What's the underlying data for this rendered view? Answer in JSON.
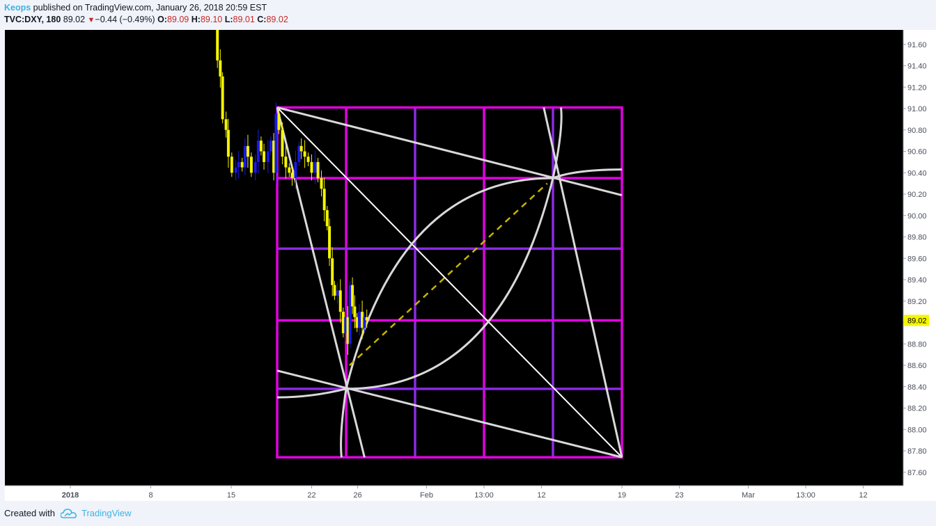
{
  "header": {
    "author": "Keops",
    "published": " published on TradingView.com, January 26, 2018 20:59 EST",
    "symbol": "TVC:DXY, 180",
    "last": "89.02",
    "down_arrow": "▼",
    "change": "−0.44 (−0.49%)",
    "o_label": "O:",
    "o_value": "89.09",
    "h_label": "H:",
    "h_value": "89.10",
    "l_label": "L:",
    "l_value": "89.01",
    "c_label": "C:",
    "c_value": "89.02"
  },
  "footer": {
    "created_with": "Created with",
    "brand": "TradingView",
    "logo_icon": "tradingview-cloud-icon"
  },
  "chart_data": {
    "type": "candlestick",
    "y_ticks": [
      "91.60",
      "91.40",
      "91.20",
      "91.00",
      "90.80",
      "90.60",
      "90.40",
      "90.20",
      "90.00",
      "89.80",
      "89.60",
      "89.40",
      "89.20",
      "89.00",
      "88.80",
      "88.60",
      "88.40",
      "88.20",
      "88.00",
      "87.80",
      "87.60"
    ],
    "ylim": [
      87.55,
      91.65
    ],
    "x_ticks": [
      {
        "label": "2018",
        "x": 1.0
      },
      {
        "label": "8",
        "x": 8.0
      },
      {
        "label": "15",
        "x": 15.0
      },
      {
        "label": "22",
        "x": 22.0
      },
      {
        "label": "26",
        "x": 26.0
      },
      {
        "label": "Feb",
        "x": 32.0
      },
      {
        "label": "13:00",
        "x": 37.0
      },
      {
        "label": "12",
        "x": 42.0
      },
      {
        "label": "19",
        "x": 49.0
      },
      {
        "label": "23",
        "x": 54.0
      },
      {
        "label": "Mar",
        "x": 60.0
      },
      {
        "label": "13:00",
        "x": 65.0
      },
      {
        "label": "12",
        "x": 70.0
      }
    ],
    "last_price": "89.02",
    "colors": {
      "up": "#1a1ae6",
      "down": "#f5f500",
      "grid_a": "#8a2be2",
      "grid_b": "#e100e1",
      "lines": "#d9d9d9",
      "dashed": "#c8b400",
      "price_tag": "#f5f500"
    },
    "price_path": [
      [
        13.6,
        91.75
      ],
      [
        13.8,
        91.45
      ],
      [
        14.05,
        91.3
      ],
      [
        14.25,
        90.9
      ],
      [
        14.55,
        90.8
      ],
      [
        14.75,
        90.55
      ],
      [
        15.05,
        90.4
      ],
      [
        15.4,
        90.45
      ],
      [
        15.65,
        90.5
      ],
      [
        15.95,
        90.45
      ],
      [
        16.2,
        90.65
      ],
      [
        16.45,
        90.55
      ],
      [
        16.75,
        90.4
      ],
      [
        17.1,
        90.5
      ],
      [
        17.35,
        90.7
      ],
      [
        17.6,
        90.6
      ],
      [
        17.85,
        90.5
      ],
      [
        18.2,
        90.6
      ],
      [
        18.45,
        90.7
      ],
      [
        18.7,
        90.4
      ],
      [
        18.9,
        90.95
      ],
      [
        19.15,
        90.8
      ],
      [
        19.45,
        90.55
      ],
      [
        19.75,
        90.45
      ],
      [
        20.05,
        90.4
      ],
      [
        20.3,
        90.35
      ],
      [
        20.6,
        90.5
      ],
      [
        20.9,
        90.65
      ],
      [
        21.1,
        90.6
      ],
      [
        21.4,
        90.55
      ],
      [
        21.7,
        90.5
      ],
      [
        22.0,
        90.4
      ],
      [
        22.3,
        90.5
      ],
      [
        22.55,
        90.35
      ],
      [
        22.85,
        90.25
      ],
      [
        23.1,
        90.05
      ],
      [
        23.35,
        89.9
      ],
      [
        23.55,
        89.6
      ],
      [
        23.8,
        89.35
      ],
      [
        24.0,
        89.25
      ],
      [
        24.25,
        89.3
      ],
      [
        24.5,
        89.1
      ],
      [
        24.75,
        88.9
      ],
      [
        24.95,
        89.05
      ],
      [
        25.15,
        88.8
      ],
      [
        25.35,
        89.35
      ],
      [
        25.55,
        89.15
      ],
      [
        25.75,
        89.05
      ],
      [
        25.95,
        88.95
      ],
      [
        26.15,
        89.1
      ],
      [
        26.4,
        88.95
      ],
      [
        26.6,
        89.05
      ],
      [
        26.8,
        89.02
      ]
    ],
    "gann_box": {
      "x0": 19,
      "x1": 49,
      "y_low": 87.74,
      "y_high": 91.01,
      "v_lines": [
        25,
        31,
        37,
        43
      ],
      "h_levels": [
        90.35,
        89.69,
        89.02,
        88.38
      ]
    }
  }
}
